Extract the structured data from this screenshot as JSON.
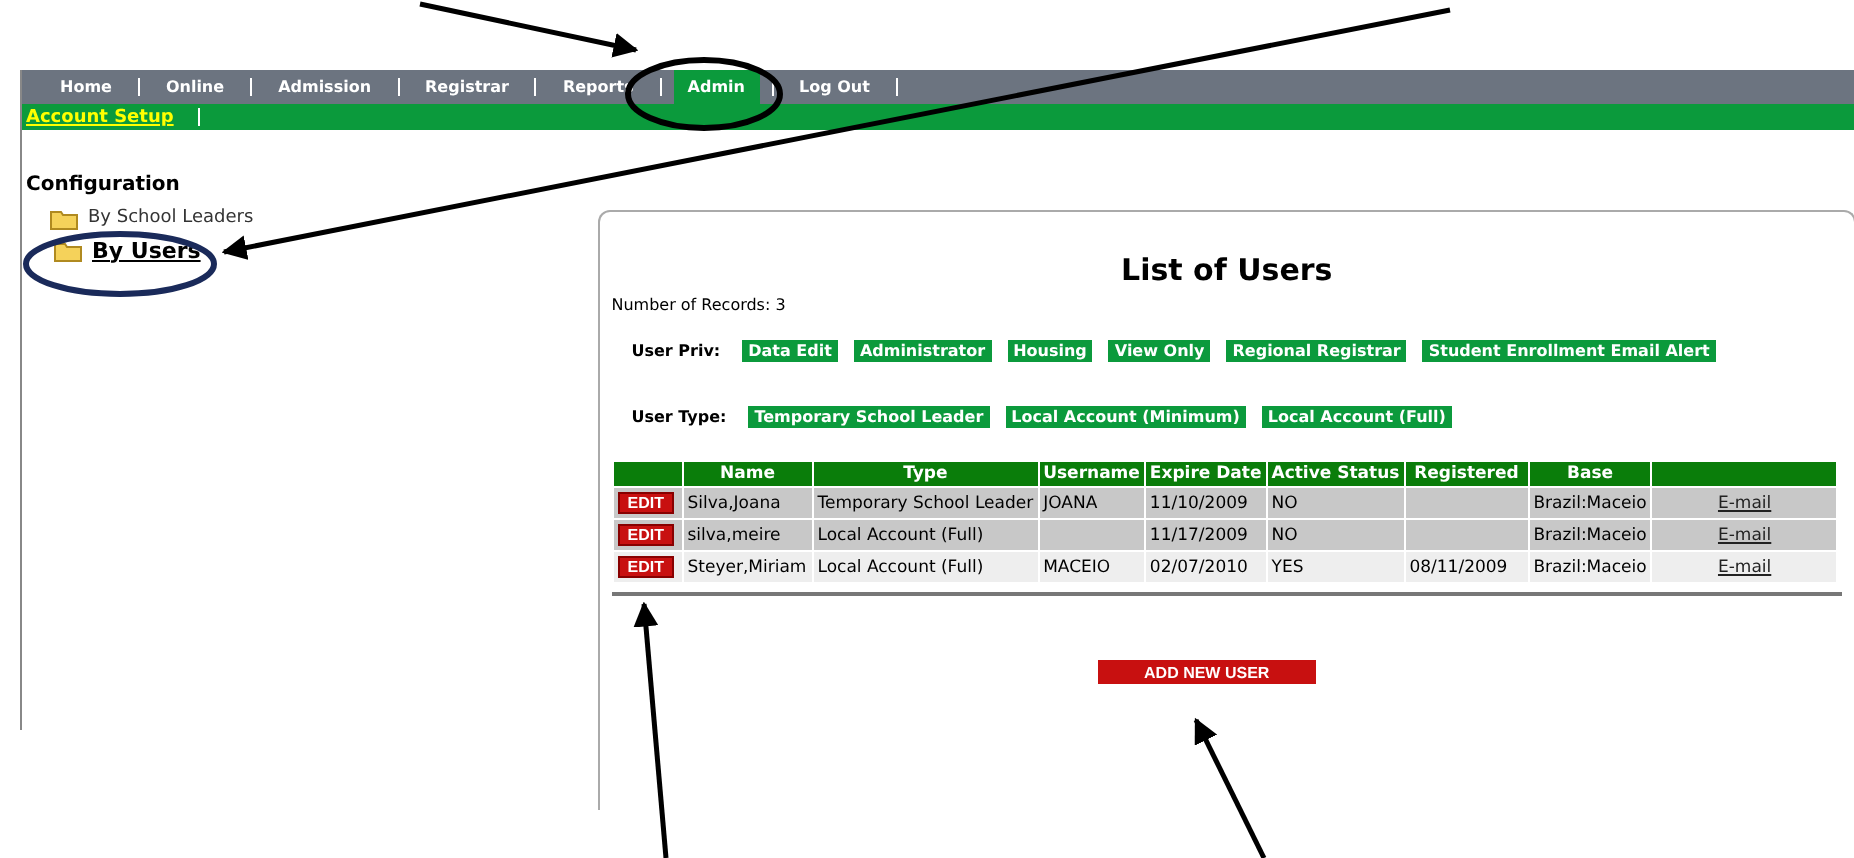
{
  "nav": {
    "items": [
      {
        "label": "Home",
        "selected": false
      },
      {
        "label": "Online",
        "selected": false
      },
      {
        "label": "Admission",
        "selected": false
      },
      {
        "label": "Registrar",
        "selected": false
      },
      {
        "label": "Reports",
        "selected": false
      },
      {
        "label": "Admin",
        "selected": true
      },
      {
        "label": "Log Out",
        "selected": false
      }
    ]
  },
  "subnav": {
    "items": [
      {
        "label": "Account Setup",
        "selected": true
      }
    ]
  },
  "sidebar": {
    "title": "Configuration",
    "items": [
      {
        "label": "By School Leaders",
        "selected": false
      },
      {
        "label": "By Users",
        "selected": true
      }
    ]
  },
  "panel": {
    "title": "List of Users",
    "record_count": "Number of Records: 3",
    "filters": [
      {
        "label": "User Priv:",
        "chips": [
          "Data Edit",
          "Administrator",
          "Housing",
          "View Only",
          "Regional Registrar",
          "Student Enrollment Email Alert"
        ]
      },
      {
        "label": "User Type:",
        "chips": [
          "Temporary School Leader",
          "Local Account (Minimum)",
          "Local Account (Full)"
        ]
      }
    ],
    "table": {
      "columns": [
        "Name",
        "Type",
        "Username",
        "Expire Date",
        "Active Status",
        "Registered",
        "Base"
      ],
      "rows": [
        {
          "action": "EDIT",
          "cells": [
            "Silva,Joana",
            "Temporary School Leader",
            "JOANA",
            "11/10/2009",
            "NO",
            "",
            "Brazil:Maceio"
          ],
          "link": "E-mail",
          "highlighted": true
        },
        {
          "action": "EDIT",
          "cells": [
            "silva,meire",
            "Local Account (Full)",
            "",
            "11/17/2009",
            "NO",
            "",
            "Brazil:Maceio"
          ],
          "link": "E-mail",
          "highlighted": true
        },
        {
          "action": "EDIT",
          "cells": [
            "Steyer,Miriam",
            "Local Account (Full)",
            "MACEIO",
            "02/07/2010",
            "YES",
            "08/11/2009",
            "Brazil:Maceio"
          ],
          "link": "E-mail",
          "highlighted": false
        }
      ]
    },
    "add_button": "ADD NEW USER"
  },
  "annotations": [
    {
      "kind": "arrow"
    },
    {
      "kind": "arrow"
    },
    {
      "kind": "arrow"
    },
    {
      "kind": "arrow"
    },
    {
      "kind": "ellipse"
    },
    {
      "kind": "ellipse"
    }
  ]
}
